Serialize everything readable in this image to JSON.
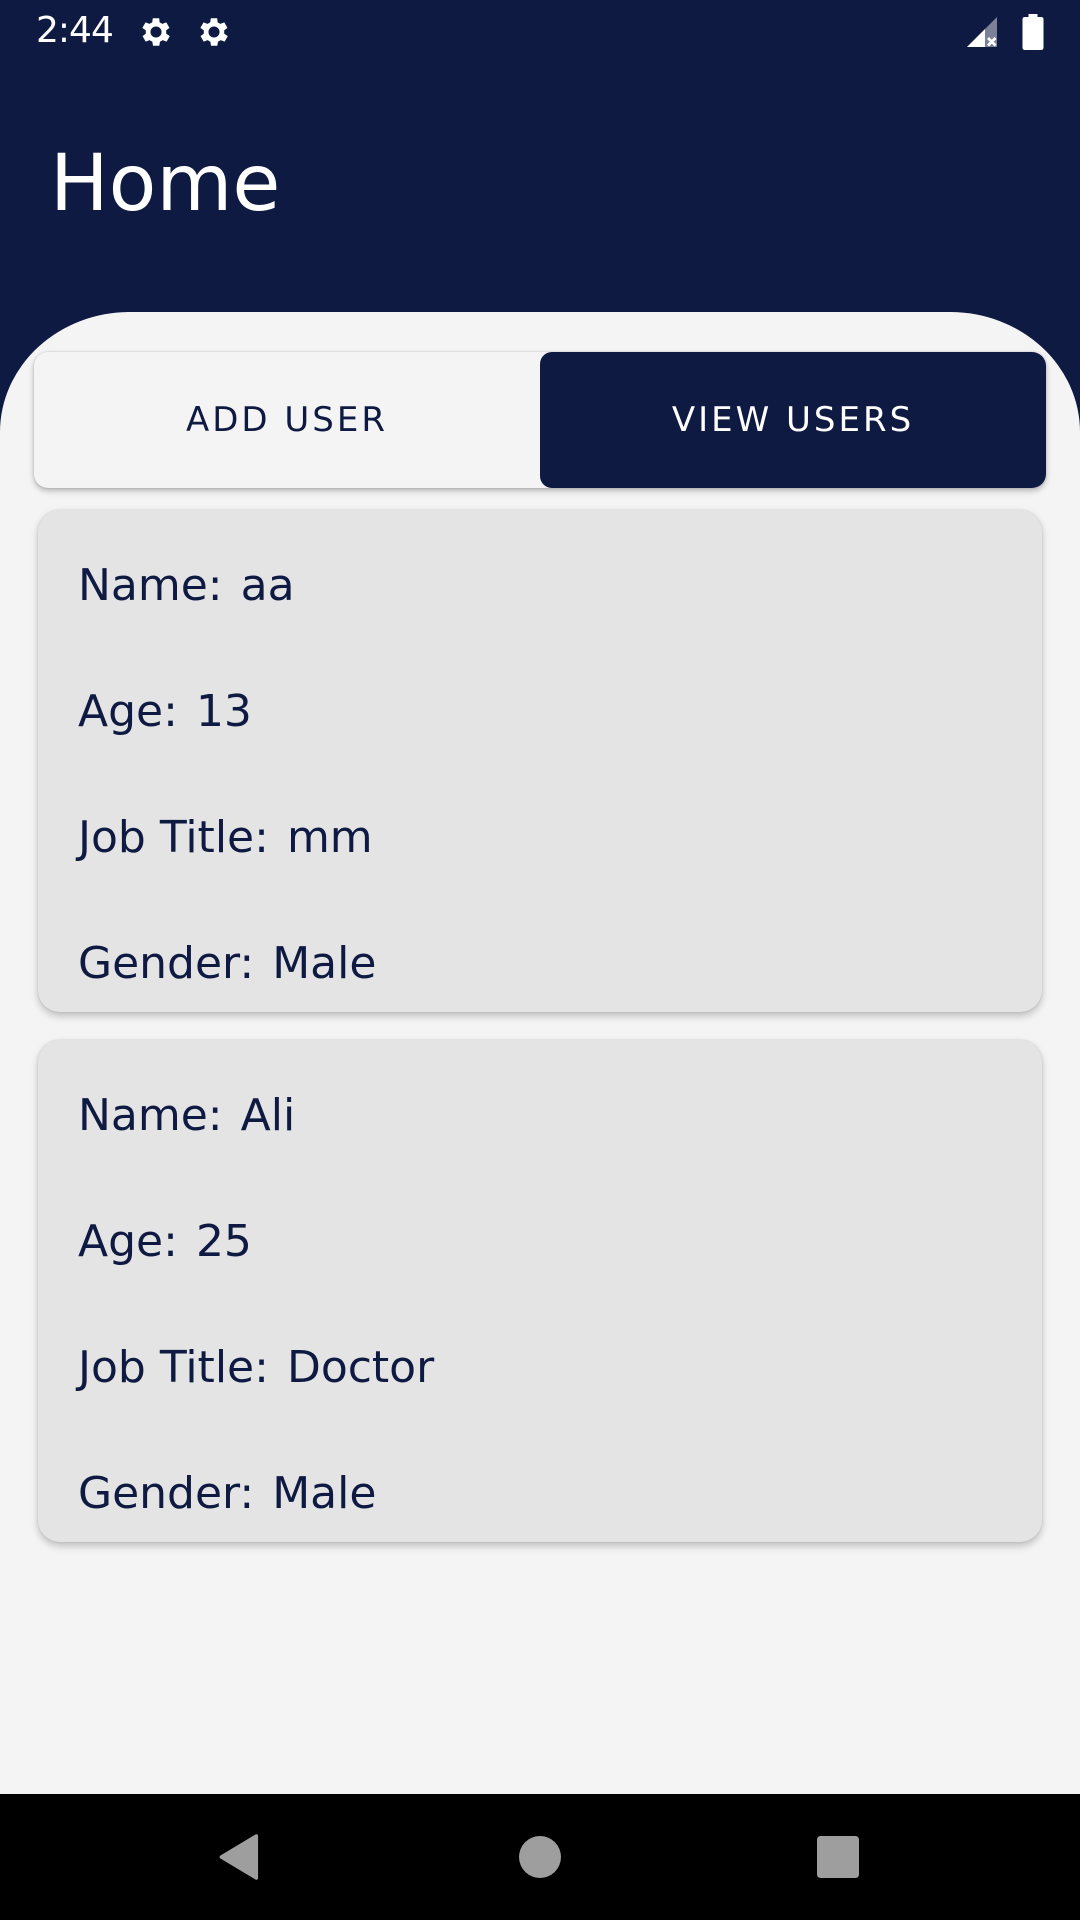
{
  "status_bar": {
    "time": "2:44",
    "icons": [
      "gear-icon",
      "gear-icon",
      "signal-icon",
      "battery-icon"
    ]
  },
  "app_bar": {
    "title": "Home"
  },
  "tabs": [
    {
      "label": "ADD USER",
      "active": false
    },
    {
      "label": "VIEW USERS",
      "active": true
    }
  ],
  "users": [
    {
      "name_label": "Name:",
      "name": "aa",
      "age_label": "Age:",
      "age": "13",
      "job_label": "Job Title:",
      "job": "mm",
      "gender_label": "Gender:",
      "gender": "Male"
    },
    {
      "name_label": "Name:",
      "name": "Ali",
      "age_label": "Age:",
      "age": "25",
      "job_label": "Job Title:",
      "job": "Doctor",
      "gender_label": "Gender:",
      "gender": "Male"
    }
  ],
  "nav_bar": {
    "buttons": [
      "back-icon",
      "home-icon",
      "recents-icon"
    ]
  },
  "colors": {
    "primary": "#0f1a42",
    "surface": "#f4f4f4",
    "card": "#e4e4e4"
  }
}
